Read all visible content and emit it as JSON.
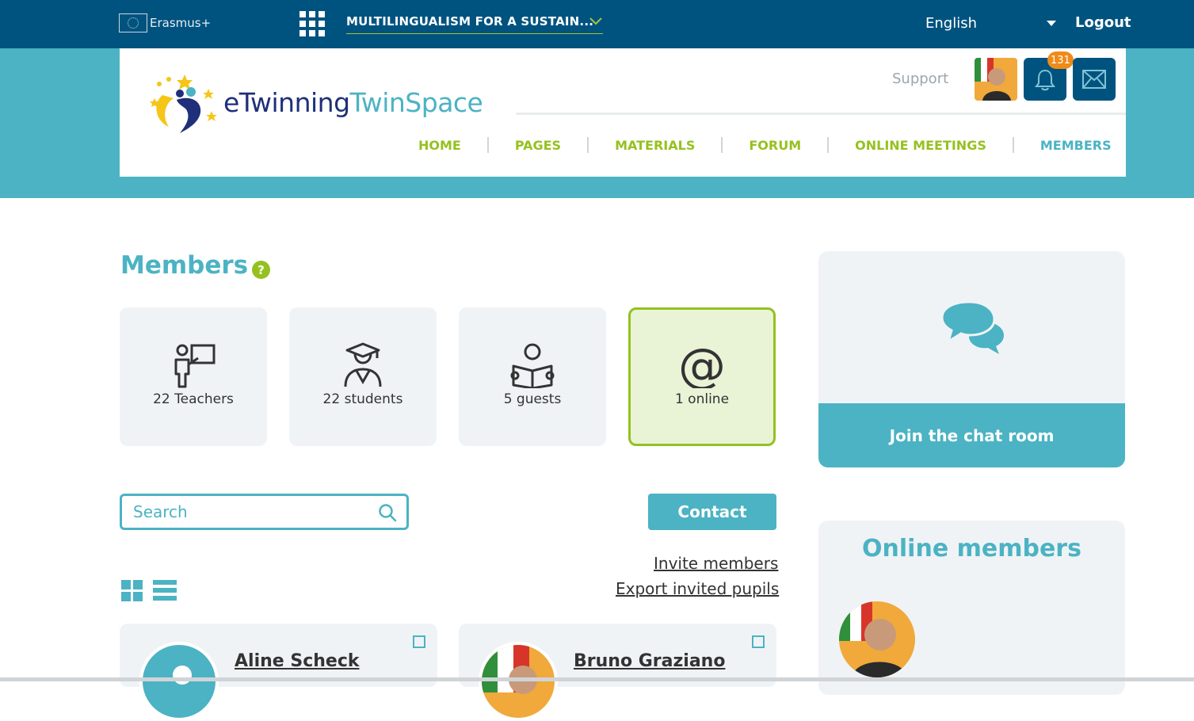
{
  "topbar": {
    "brand": "Erasmus+",
    "project": "MULTILINGUALISM FOR A SUSTAIN...",
    "language": "English",
    "logout": "Logout"
  },
  "header": {
    "logo_main": "eTwinning",
    "logo_sub": "TwinSpace",
    "support": "Support",
    "notifications_count": "131",
    "nav": [
      {
        "label": "HOME",
        "active": false
      },
      {
        "label": "PAGES",
        "active": false
      },
      {
        "label": "MATERIALS",
        "active": false
      },
      {
        "label": "FORUM",
        "active": false
      },
      {
        "label": "ONLINE MEETINGS",
        "active": false
      },
      {
        "label": "MEMBERS",
        "active": true
      }
    ]
  },
  "main": {
    "title": "Members",
    "help": "?",
    "stats": [
      {
        "label": "22 Teachers",
        "icon": "teacher-icon"
      },
      {
        "label": "22 students",
        "icon": "student-icon"
      },
      {
        "label": "5 guests",
        "icon": "guest-reader-icon"
      },
      {
        "label": "1 online",
        "icon": "at-sign-icon"
      }
    ],
    "search_placeholder": "Search",
    "contact": "Contact",
    "invite": "Invite members",
    "export": "Export invited pupils",
    "members": [
      {
        "name": "Aline Scheck"
      },
      {
        "name": "Bruno Graziano"
      }
    ]
  },
  "sidebar": {
    "chat_button": "Join the chat room",
    "online_title": "Online members"
  },
  "colors": {
    "topbar": "#00537f",
    "teal": "#4bb3c3",
    "green": "#95c11f",
    "badge": "#f08a18"
  }
}
